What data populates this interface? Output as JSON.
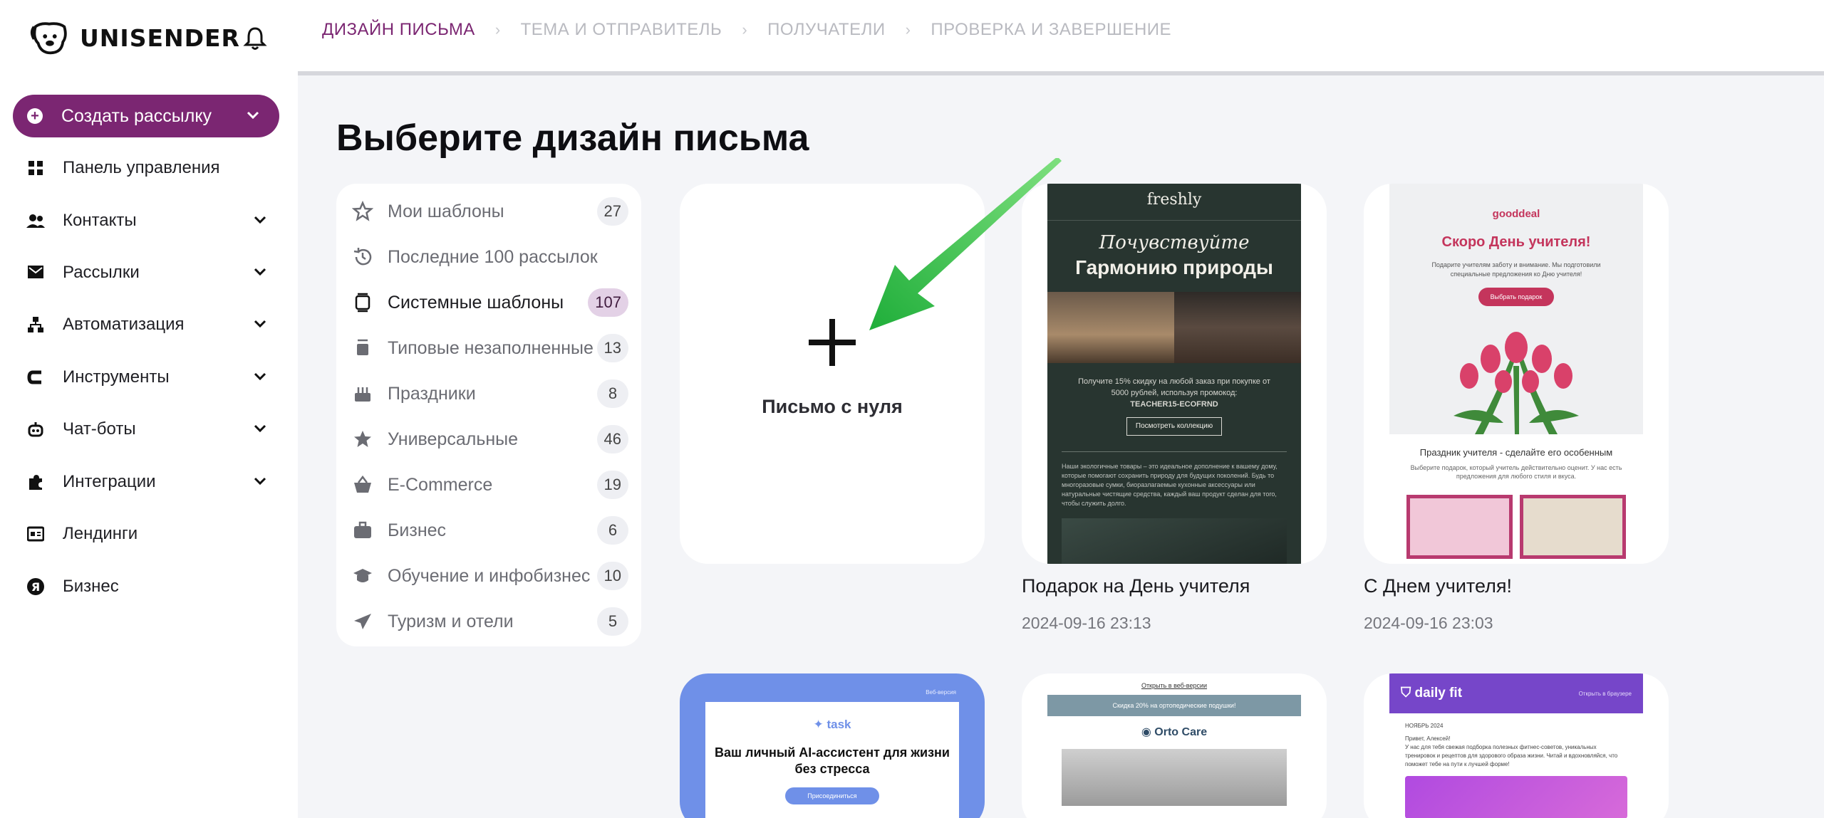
{
  "brand": {
    "name": "UNISENDER"
  },
  "sidebar": {
    "create_label": "Создать рассылку",
    "items": [
      {
        "label": "Панель управления",
        "icon": "dashboard-icon",
        "has_chevron": false
      },
      {
        "label": "Контакты",
        "icon": "contacts-icon",
        "has_chevron": true
      },
      {
        "label": "Рассылки",
        "icon": "mail-icon",
        "has_chevron": true
      },
      {
        "label": "Автоматизация",
        "icon": "automation-icon",
        "has_chevron": true
      },
      {
        "label": "Инструменты",
        "icon": "tools-icon",
        "has_chevron": true
      },
      {
        "label": "Чат-боты",
        "icon": "chatbot-icon",
        "has_chevron": true
      },
      {
        "label": "Интеграции",
        "icon": "puzzle-icon",
        "has_chevron": true
      },
      {
        "label": "Лендинги",
        "icon": "landing-icon",
        "has_chevron": false
      },
      {
        "label": "Бизнес",
        "icon": "yandex-icon",
        "has_chevron": false
      }
    ]
  },
  "steps": [
    {
      "label": "ДИЗАЙН ПИСЬМА",
      "active": true
    },
    {
      "label": "ТЕМА И ОТПРАВИТЕЛЬ",
      "active": false
    },
    {
      "label": "ПОЛУЧАТЕЛИ",
      "active": false
    },
    {
      "label": "ПРОВЕРКА И ЗАВЕРШЕНИЕ",
      "active": false
    }
  ],
  "page_title": "Выберите дизайн письма",
  "categories": [
    {
      "label": "Мои шаблоны",
      "count": "27",
      "icon": "star-icon"
    },
    {
      "label": "Последние 100 рассылок",
      "count": "",
      "icon": "history-icon"
    },
    {
      "label": "Системные шаблоны",
      "count": "107",
      "icon": "templates-icon",
      "active": true
    },
    {
      "label": "Типовые незаполненные",
      "count": "13",
      "icon": "layout-icon"
    },
    {
      "label": "Праздники",
      "count": "8",
      "icon": "cake-icon"
    },
    {
      "label": "Универсальные",
      "count": "46",
      "icon": "star-filled-icon"
    },
    {
      "label": "E-Commerce",
      "count": "19",
      "icon": "basket-icon"
    },
    {
      "label": "Бизнес",
      "count": "6",
      "icon": "briefcase-icon"
    },
    {
      "label": "Обучение и инфобизнес",
      "count": "10",
      "icon": "graduation-icon"
    },
    {
      "label": "Туризм и отели",
      "count": "5",
      "icon": "plane-icon"
    }
  ],
  "blank_card": {
    "label": "Письмо с нуля"
  },
  "templates": [
    {
      "name": "Подарок на День учителя",
      "date": "2024-09-16 23:13",
      "preview": {
        "brand": "freshly",
        "heading_italic": "Почувствуйте",
        "heading_bold": "Гармонию природы",
        "promo_prefix": "Получите",
        "promo_highlight": "15% скидку",
        "promo_rest": "на любой заказ при покупке от 5000 рублей, используя промокод:",
        "code": "TEACHER15-ECOFRND",
        "button": "Посмотреть коллекцию",
        "body": "Наши экологичные товары – это идеальное дополнение к вашему дому, которые помогают сохранить природу для будущих поколений. Будь то многоразовые сумки, биоразлагаемые кухонные аксессуары или натуральные чистящие средства, каждый ваш продукт сделан для того, чтобы служить долго."
      }
    },
    {
      "name": "С Днем учителя!",
      "date": "2024-09-16 23:03",
      "preview": {
        "brand": "gooddeal",
        "heading": "Скоро День учителя!",
        "text": "Подарите учителям заботу и внимание. Мы подготовили специальные предложения ко Дню учителя!",
        "button": "Выбрать подарок",
        "subheading": "Праздник учителя - сделайте его особенным",
        "subtext": "Выберите подарок, который учитель действительно оценит. У нас есть предложения для любого стиля и вкуса."
      }
    }
  ],
  "bottom_templates": [
    {
      "tag": "Веб-версия",
      "brand": "task",
      "heading": "Ваш личный AI-ассистент для жизни без стресса",
      "button": "Присоединиться"
    },
    {
      "link": "Открыть в веб-версии",
      "band": "Скидка 20% на ортопедические подушки!",
      "brand": "Orto Care"
    },
    {
      "brand": "daily fit",
      "tag": "Открыть в браузере",
      "date_line": "НОЯБРЬ 2024",
      "greeting": "Привет, Алексей!",
      "text": "У нас для тебя свежая подборка полезных фитнес-советов, уникальных тренировок и рецептов для здорового образа жизни. Читай и вдохновляйся, что поможет тебе на пути к лучшей форме!"
    }
  ],
  "colors": {
    "accent": "#7b2672",
    "arrow": "#2fc44a"
  }
}
